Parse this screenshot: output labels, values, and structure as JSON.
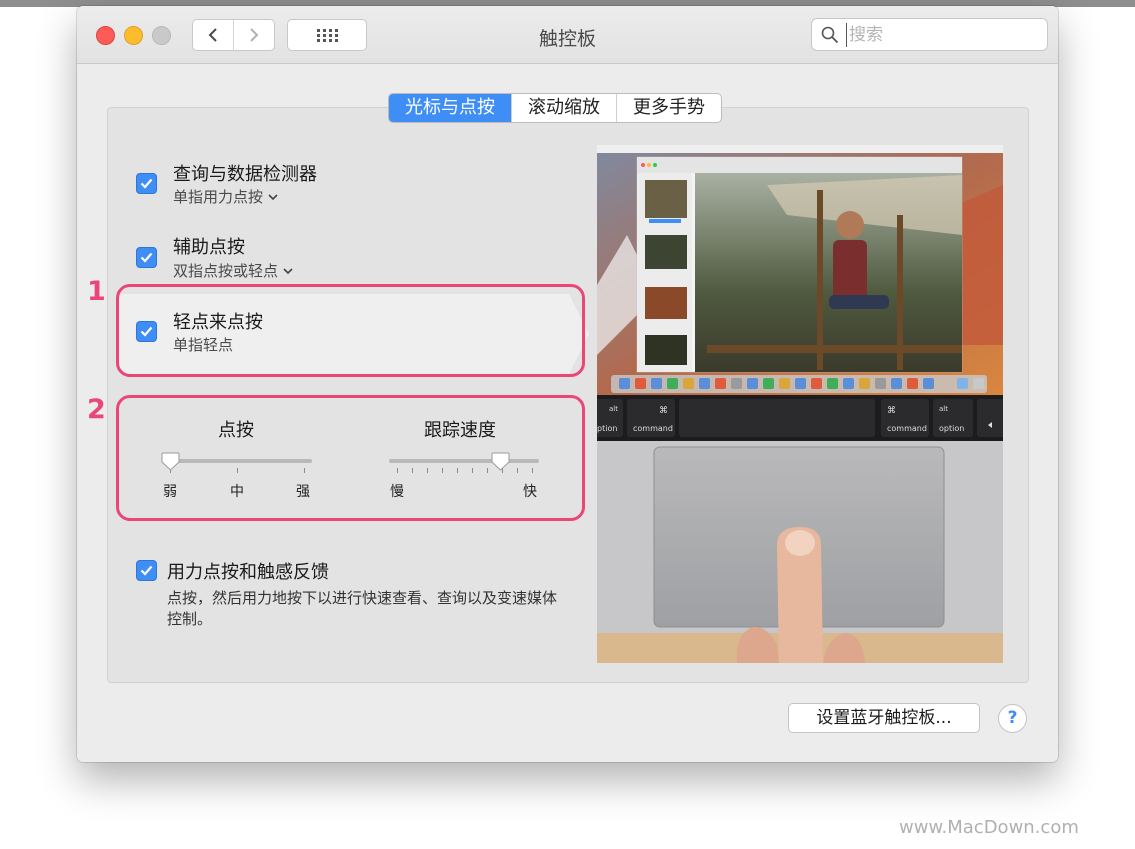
{
  "window": {
    "title": "触控板"
  },
  "search": {
    "placeholder": "搜索"
  },
  "tabs": [
    {
      "label": "光标与点按",
      "active": true
    },
    {
      "label": "滚动缩放",
      "active": false
    },
    {
      "label": "更多手势",
      "active": false
    }
  ],
  "options": {
    "lookup": {
      "title": "查询与数据检测器",
      "subtitle": "单指用力点按",
      "checked": true
    },
    "secondary_click": {
      "title": "辅助点按",
      "subtitle": "双指点按或轻点",
      "checked": true
    },
    "tap_to_click": {
      "title": "轻点来点按",
      "subtitle": "单指轻点",
      "checked": true
    },
    "force_click": {
      "title": "用力点按和触感反馈",
      "description": "点按，然后用力地按下以进行快速查看、查询以及变速媒体控制。",
      "checked": true
    }
  },
  "annotations": {
    "marker1": "1",
    "marker2": "2",
    "highlight_color": "#ea4678"
  },
  "sliders": {
    "click": {
      "label": "点按",
      "min_label": "弱",
      "mid_label": "中",
      "max_label": "强",
      "value": 0.0
    },
    "tracking": {
      "label": "跟踪速度",
      "min_label": "慢",
      "max_label": "快",
      "value": 0.8
    }
  },
  "preview": {
    "keys": {
      "left_alt": "alt",
      "left_option": "ption",
      "left_cmd_symbol": "⌘",
      "left_cmd": "command",
      "right_cmd_symbol": "⌘",
      "right_cmd": "command",
      "right_alt": "alt",
      "right_option": "option"
    }
  },
  "bluetooth_button": "设置蓝牙触控板...",
  "help_button": "?",
  "watermark": "www.MacDown.com",
  "colors": {
    "accent": "#3f8ef5",
    "window_bg": "#ececec",
    "close": "#fc5b57",
    "minimize": "#fdbc2e"
  }
}
